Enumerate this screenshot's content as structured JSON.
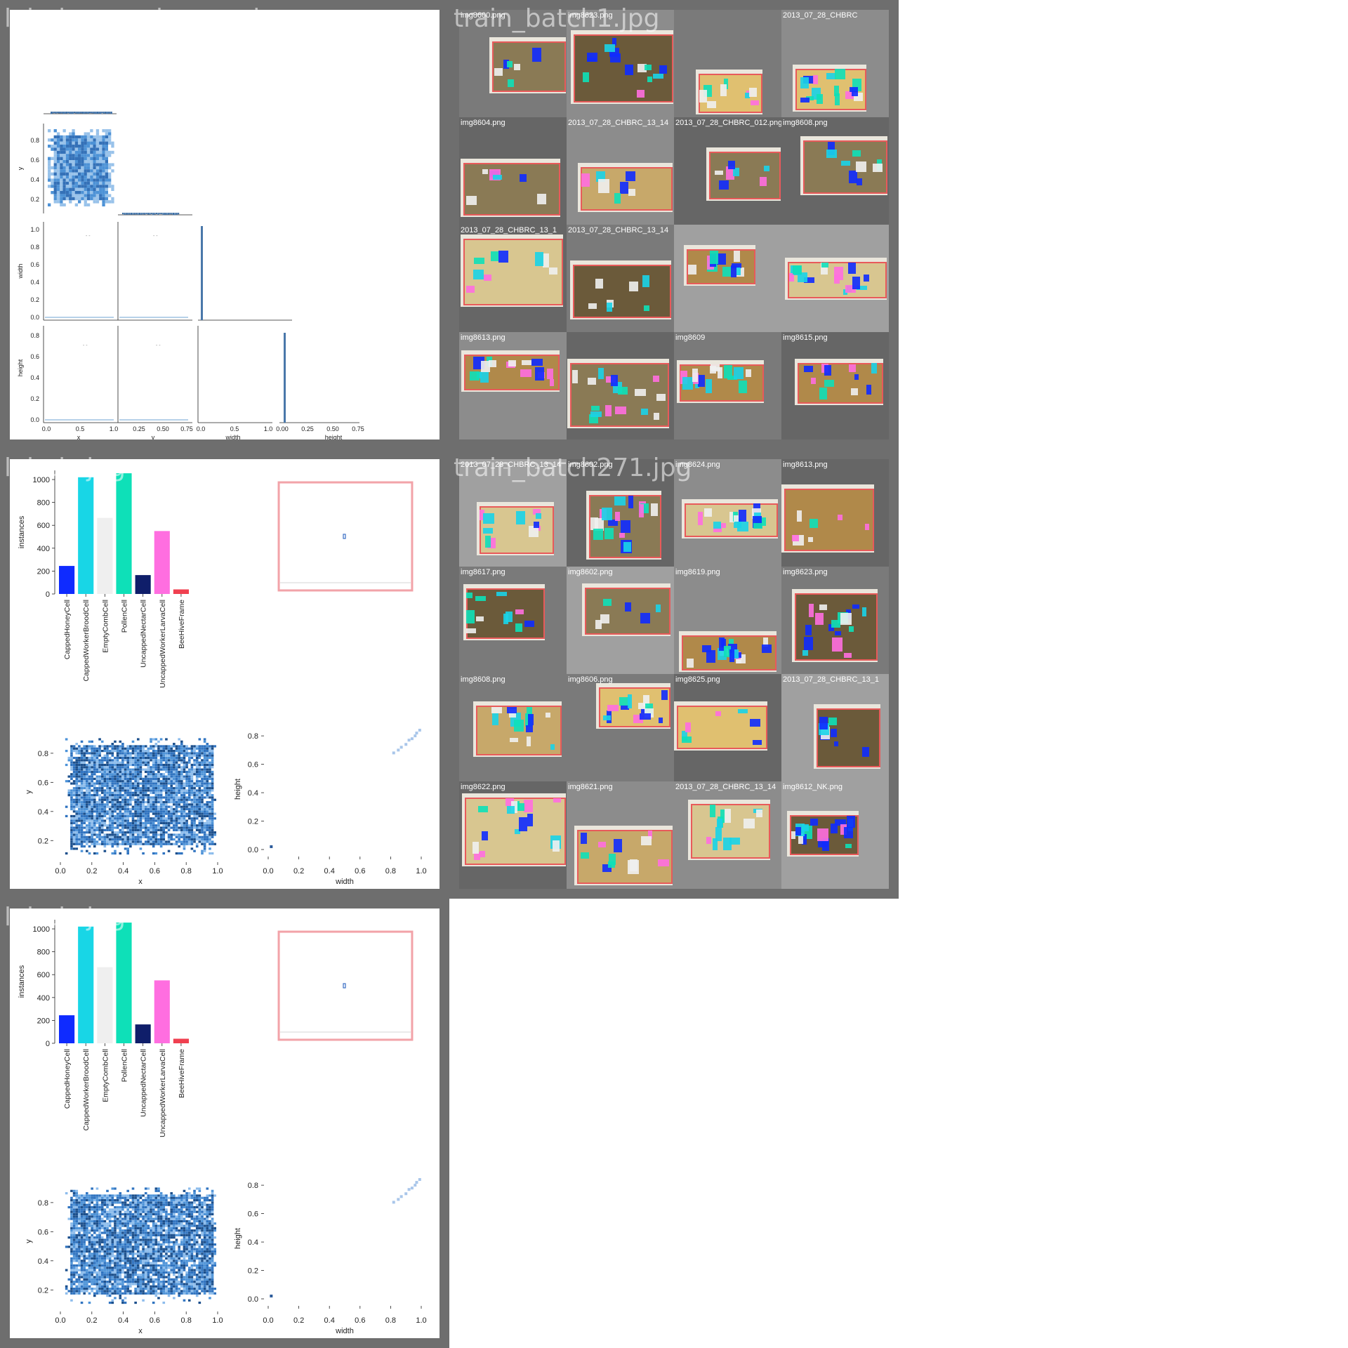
{
  "tiles": {
    "correlogram_title": "labels_correlogram.jpg",
    "batch1_title": "train_batch1.jpg",
    "labels_title_a": "labels.jpg",
    "batch271_title": "train_batch271.jpg",
    "labels_title_b": "labels.jpg"
  },
  "colors": {
    "tile_border": "#6e6e6e",
    "hist_blue": "#3b84c4",
    "dense_blue": "#1f5fa8",
    "frame_red": "#e85a5a"
  },
  "correlogram": {
    "var_names": [
      "x",
      "y",
      "width",
      "height"
    ],
    "ticks": {
      "x_diag": [
        "0.0",
        "0.5",
        "1.0"
      ],
      "y_diag": [
        "0.25",
        "0.50",
        "0.75"
      ],
      "width_diag": [
        "0.0",
        "0.5",
        "1.0"
      ],
      "height_diag": [
        "0.00",
        "0.25",
        "0.50",
        "0.75"
      ],
      "y_row": [
        "0.2",
        "0.4",
        "0.6",
        "0.8"
      ],
      "width_row": [
        "0.0",
        "0.2",
        "0.4",
        "0.6",
        "0.8",
        "1.0"
      ],
      "height_row": [
        "0.0",
        "0.2",
        "0.4",
        "0.6",
        "0.8"
      ]
    }
  },
  "chart_data": [
    {
      "type": "bar",
      "categories": [
        "CappedHoneyCell",
        "CappedWorkerBroodCell",
        "EmptyCombCell",
        "PollenCell",
        "UncappedNectarCell",
        "UncappedWorkerLarvaCell",
        "BeeHiveFrame"
      ],
      "values": [
        245,
        1020,
        665,
        1055,
        165,
        550,
        40
      ],
      "colors": [
        "#0f2bff",
        "#18d6e6",
        "#efefef",
        "#0ee0b8",
        "#0f1e6a",
        "#ff6ee0",
        "#f04050"
      ],
      "ylabel": "instances",
      "ylim": [
        0,
        1080
      ],
      "yticks": [
        0,
        200,
        400,
        600,
        800,
        1000
      ]
    },
    {
      "type": "heatmap",
      "xlabel": "x",
      "ylabel": "y",
      "xlim": [
        0,
        1
      ],
      "ylim": [
        0.1,
        0.92
      ],
      "xticks": [
        "0.0",
        "0.2",
        "0.4",
        "0.6",
        "0.8",
        "1.0"
      ],
      "yticks": [
        "0.2",
        "0.4",
        "0.6",
        "0.8"
      ]
    },
    {
      "type": "scatter",
      "xlabel": "width",
      "ylabel": "height",
      "xlim": [
        0,
        1
      ],
      "ylim": [
        0,
        0.85
      ],
      "xticks": [
        "0.0",
        "0.2",
        "0.4",
        "0.6",
        "0.8",
        "1.0"
      ],
      "yticks": [
        "0.0",
        "0.2",
        "0.4",
        "0.6",
        "0.8"
      ],
      "points": [
        [
          0.02,
          0.02
        ],
        [
          0.82,
          0.68
        ],
        [
          0.85,
          0.7
        ],
        [
          0.87,
          0.72
        ],
        [
          0.9,
          0.74
        ],
        [
          0.92,
          0.77
        ],
        [
          0.94,
          0.78
        ],
        [
          0.96,
          0.8
        ],
        [
          0.97,
          0.82
        ],
        [
          0.99,
          0.84
        ]
      ]
    }
  ],
  "batch1": {
    "labels": [
      "img8600.png",
      "img8623.png",
      "",
      "2013_07_28_CHBRC",
      "img8604.png",
      "2013_07_28_CHBRC_13_14",
      "2013_07_28_CHBRC_012.png",
      "img8608.png",
      "2013_07_28_CHBRC_13_1",
      "2013_07_28_CHBRC_13_14",
      "",
      "",
      "img8613.png",
      "",
      "img8609",
      "img8615.png"
    ]
  },
  "batch271": {
    "labels": [
      "2013_07_28_CHBRC_13_14",
      "img8602.png",
      "img8624.png",
      "img8613.png",
      "img8617.png",
      "img8602.png",
      "img8619.png",
      "img8623.png",
      "img8608.png",
      "img8606.png",
      "img8625.png",
      "2013_07_28_CHBRC_13_1",
      "img8622.png",
      "img8621.png",
      "2013_07_28_CHBRC_13_14",
      "img8612_NK.png"
    ]
  }
}
